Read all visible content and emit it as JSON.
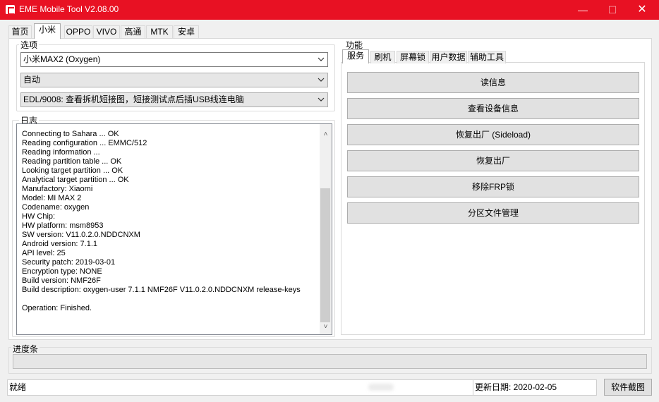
{
  "window": {
    "title": "EME Mobile Tool V2.08.00"
  },
  "main_tabs": [
    {
      "label": "首页"
    },
    {
      "label": "小米"
    },
    {
      "label": "OPPO"
    },
    {
      "label": "VIVO"
    },
    {
      "label": "高通"
    },
    {
      "label": "MTK"
    },
    {
      "label": "安卓"
    }
  ],
  "options": {
    "label": "选项",
    "model_select": "小米MAX2 (Oxygen)",
    "mode_select": "自动",
    "edl_select": "EDL/9008: 查看拆机短接图，短接测试点后插USB线连电脑"
  },
  "log": {
    "label": "日志",
    "lines": [
      "Connecting to Sahara ... OK",
      "Reading configuration ... EMMC/512",
      "Reading information ...",
      "Reading partition table ... OK",
      "Looking target partition ... OK",
      "Analytical target partition ... OK",
      "Manufactory: Xiaomi",
      "Model: MI MAX 2",
      "Codename: oxygen",
      "HW Chip:",
      "HW platform: msm8953",
      "SW version: V11.0.2.0.NDDCNXM",
      "Android version: 7.1.1",
      "API level: 25",
      "Security patch: 2019-03-01",
      "Encryption type: NONE",
      "Build version: NMF26F",
      "Build description: oxygen-user 7.1.1 NMF26F V11.0.2.0.NDDCNXM release-keys",
      "",
      "Operation: Finished."
    ]
  },
  "functions": {
    "label": "功能",
    "tabs": [
      {
        "label": "服务"
      },
      {
        "label": "刷机"
      },
      {
        "label": "屏幕锁"
      },
      {
        "label": "用户数据"
      },
      {
        "label": "辅助工具"
      }
    ],
    "buttons": [
      {
        "label": "读信息"
      },
      {
        "label": "查看设备信息"
      },
      {
        "label": "恢复出厂 (Sideload)"
      },
      {
        "label": "恢复出厂"
      },
      {
        "label": "移除FRP锁"
      },
      {
        "label": "分区文件管理"
      }
    ]
  },
  "progress": {
    "label": "进度条",
    "value": 0
  },
  "status": {
    "state": "就绪",
    "update_date": "更新日期: 2020-02-05",
    "snapshot_button": "软件截图"
  }
}
